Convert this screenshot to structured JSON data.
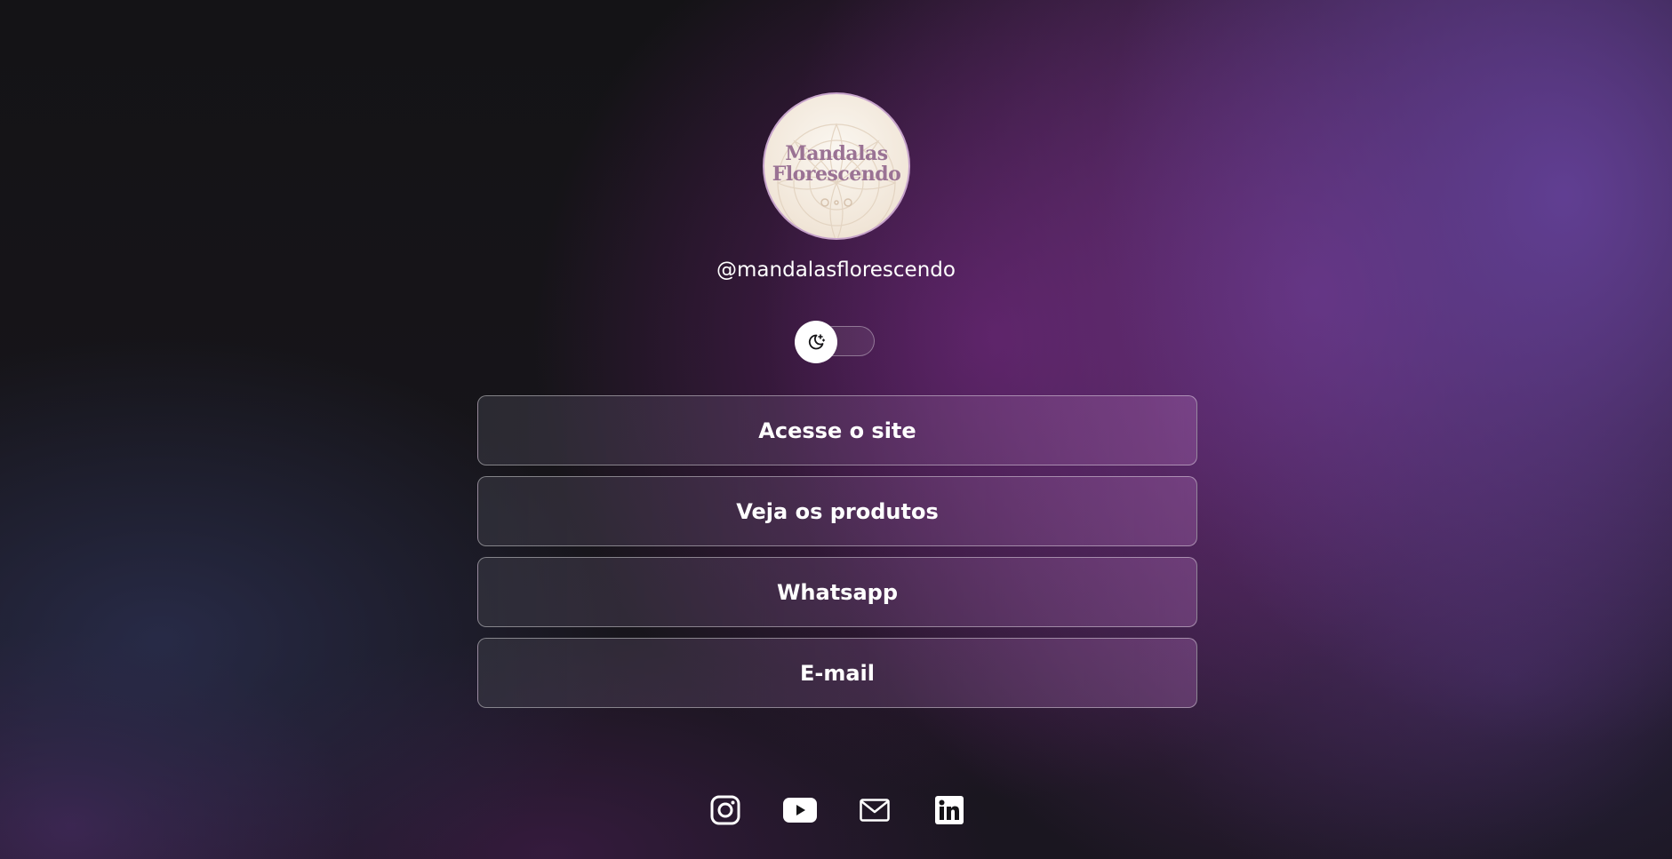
{
  "profile": {
    "avatar_text_line1": "Mandalas",
    "avatar_text_line2": "Florescendo",
    "username": "@mandalasflorescendo"
  },
  "theme_toggle": {
    "icon": "moon-stars-icon",
    "state": "dark"
  },
  "links": [
    {
      "label": "Acesse o site"
    },
    {
      "label": "Veja os produtos"
    },
    {
      "label": "Whatsapp"
    },
    {
      "label": "E-mail"
    }
  ],
  "social_icons": [
    "instagram-icon",
    "youtube-icon",
    "email-icon",
    "linkedin-icon"
  ],
  "colors": {
    "accent": "#9a7294",
    "background_dark": "#141316",
    "purple_glow": "#6e3282",
    "text": "#ffffff"
  }
}
